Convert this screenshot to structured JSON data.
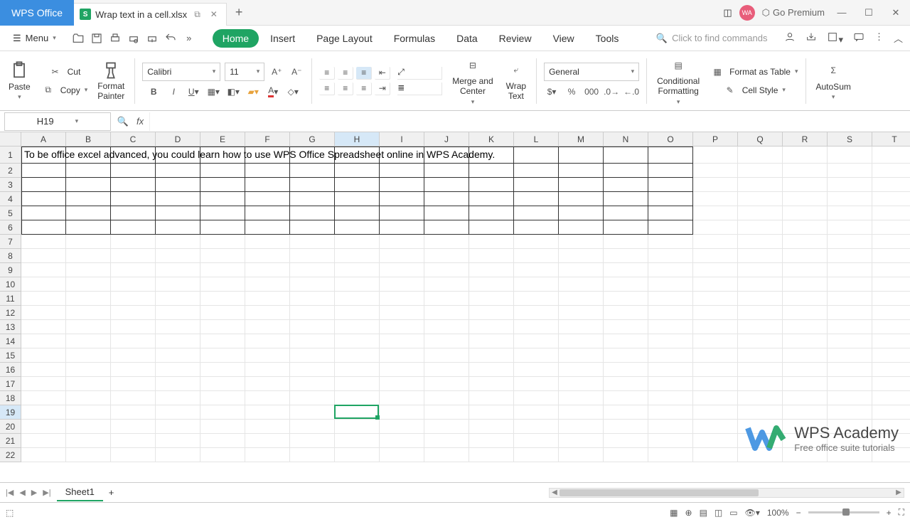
{
  "app": {
    "brand": "WPS Office",
    "tab_title": "Wrap text in a cell.xlsx",
    "premium": "Go Premium",
    "avatar": "WA"
  },
  "menu": {
    "label": "Menu",
    "tabs": [
      "Home",
      "Insert",
      "Page Layout",
      "Formulas",
      "Data",
      "Review",
      "View",
      "Tools"
    ],
    "search_placeholder": "Click to find commands"
  },
  "ribbon": {
    "paste": "Paste",
    "cut": "Cut",
    "copy": "Copy",
    "format_painter": "Format\nPainter",
    "font_name": "Calibri",
    "font_size": "11",
    "merge": "Merge and\nCenter",
    "wrap": "Wrap\nText",
    "num_format": "General",
    "cond_fmt": "Conditional\nFormatting",
    "fmt_table": "Format as Table",
    "cell_style": "Cell Style",
    "autosum": "AutoSum"
  },
  "namebox": "H19",
  "columns": [
    "A",
    "B",
    "C",
    "D",
    "E",
    "F",
    "G",
    "H",
    "I",
    "J",
    "K",
    "L",
    "M",
    "N",
    "O",
    "P",
    "Q",
    "R",
    "S",
    "T"
  ],
  "rows": 22,
  "selected": {
    "col": "H",
    "row": 19,
    "colIndex": 7,
    "rowIndex": 18
  },
  "cell_a1": "To be office excel advanced, you could learn how to use WPS Office Spreadsheet online in WPS Academy.",
  "sheet": {
    "active": "Sheet1"
  },
  "zoom": "100%",
  "watermark": {
    "title": "WPS Academy",
    "sub": "Free office suite tutorials"
  }
}
